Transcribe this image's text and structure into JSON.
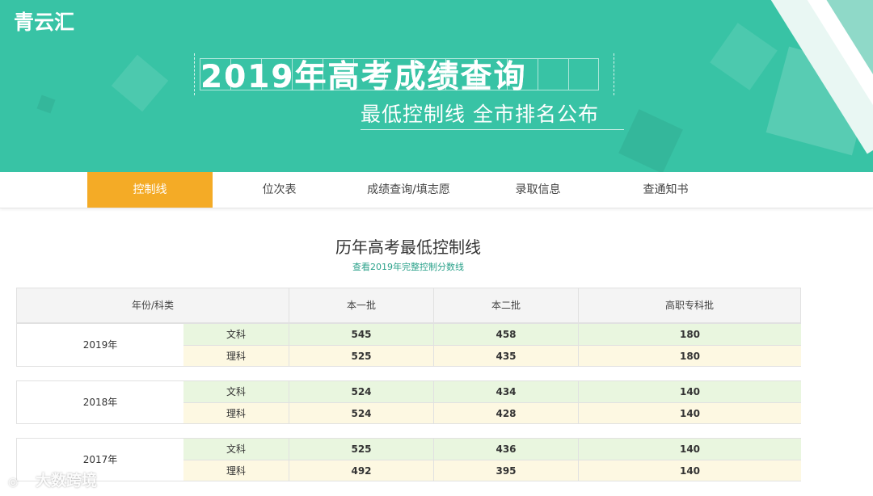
{
  "brand": {
    "logo_text": "青云汇"
  },
  "banner": {
    "title": "2019年高考成绩查询",
    "subtitle": "最低控制线  全市排名公布"
  },
  "nav": {
    "items": [
      {
        "label": "控制线",
        "active": true
      },
      {
        "label": "位次表",
        "active": false
      },
      {
        "label": "成绩查询/填志愿",
        "active": false
      },
      {
        "label": "录取信息",
        "active": false
      },
      {
        "label": "查通知书",
        "active": false
      }
    ]
  },
  "section": {
    "title": "历年高考最低控制线",
    "link": "查看2019年完整控制分数线"
  },
  "table": {
    "headers": [
      "年份/科类",
      "本一批",
      "本二批",
      "高职专科批"
    ],
    "years": [
      {
        "year": "2019年",
        "rows": [
          {
            "type": "文科",
            "b1": "545",
            "b2": "458",
            "zk": "180"
          },
          {
            "type": "理科",
            "b1": "525",
            "b2": "435",
            "zk": "180"
          }
        ]
      },
      {
        "year": "2018年",
        "rows": [
          {
            "type": "文科",
            "b1": "524",
            "b2": "434",
            "zk": "140"
          },
          {
            "type": "理科",
            "b1": "524",
            "b2": "428",
            "zk": "140"
          }
        ]
      },
      {
        "year": "2017年",
        "rows": [
          {
            "type": "文科",
            "b1": "525",
            "b2": "436",
            "zk": "140"
          },
          {
            "type": "理科",
            "b1": "492",
            "b2": "395",
            "zk": "140"
          }
        ]
      }
    ]
  },
  "watermark": {
    "text": "大数跨境"
  },
  "colors": {
    "banner": "#38c3a5",
    "nav_active": "#f4ab26",
    "link": "#2aa18a",
    "row_wen": "#e9f6df",
    "row_li": "#fdf8e2"
  }
}
